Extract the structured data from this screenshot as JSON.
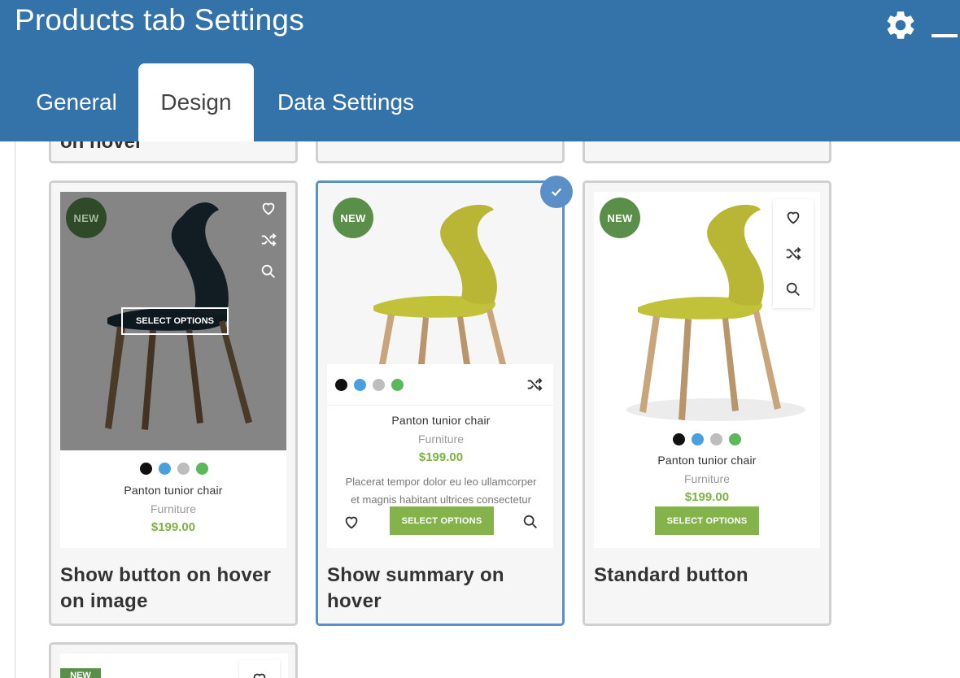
{
  "window": {
    "title": "Products tab Settings",
    "settings_icon": "gear-icon",
    "minimize_icon": "minimize-icon"
  },
  "tabs": [
    {
      "label": "General",
      "active": false
    },
    {
      "label": "Design",
      "active": true
    },
    {
      "label": "Data Settings",
      "active": false
    }
  ],
  "top_row_partial_label": "on hover",
  "product": {
    "badge": "NEW",
    "name": "Panton tunior chair",
    "category": "Furniture",
    "price": "$199.00",
    "button": "SELECT OPTIONS",
    "summary_line1": "Placerat tempor dolor eu leo ullamcorper",
    "summary_line2": "et magnis habitant ultrices consectetur",
    "swatch_colors": [
      "#111111",
      "#4a9fe0",
      "#bdbdbd",
      "#5cb85c"
    ]
  },
  "options": [
    {
      "label_line1": "Show button on hover",
      "label_line2": "on image",
      "selected": false
    },
    {
      "label_line1": "Show summary on",
      "label_line2": "hover",
      "selected": true
    },
    {
      "label_line1": "Standard button",
      "label_line2": "",
      "selected": false
    }
  ],
  "colors": {
    "header": "#3373a9",
    "selected_border": "#5b8fc8",
    "price": "#7cb342",
    "badge": "#5a8f4a",
    "button": "#84b34b"
  }
}
